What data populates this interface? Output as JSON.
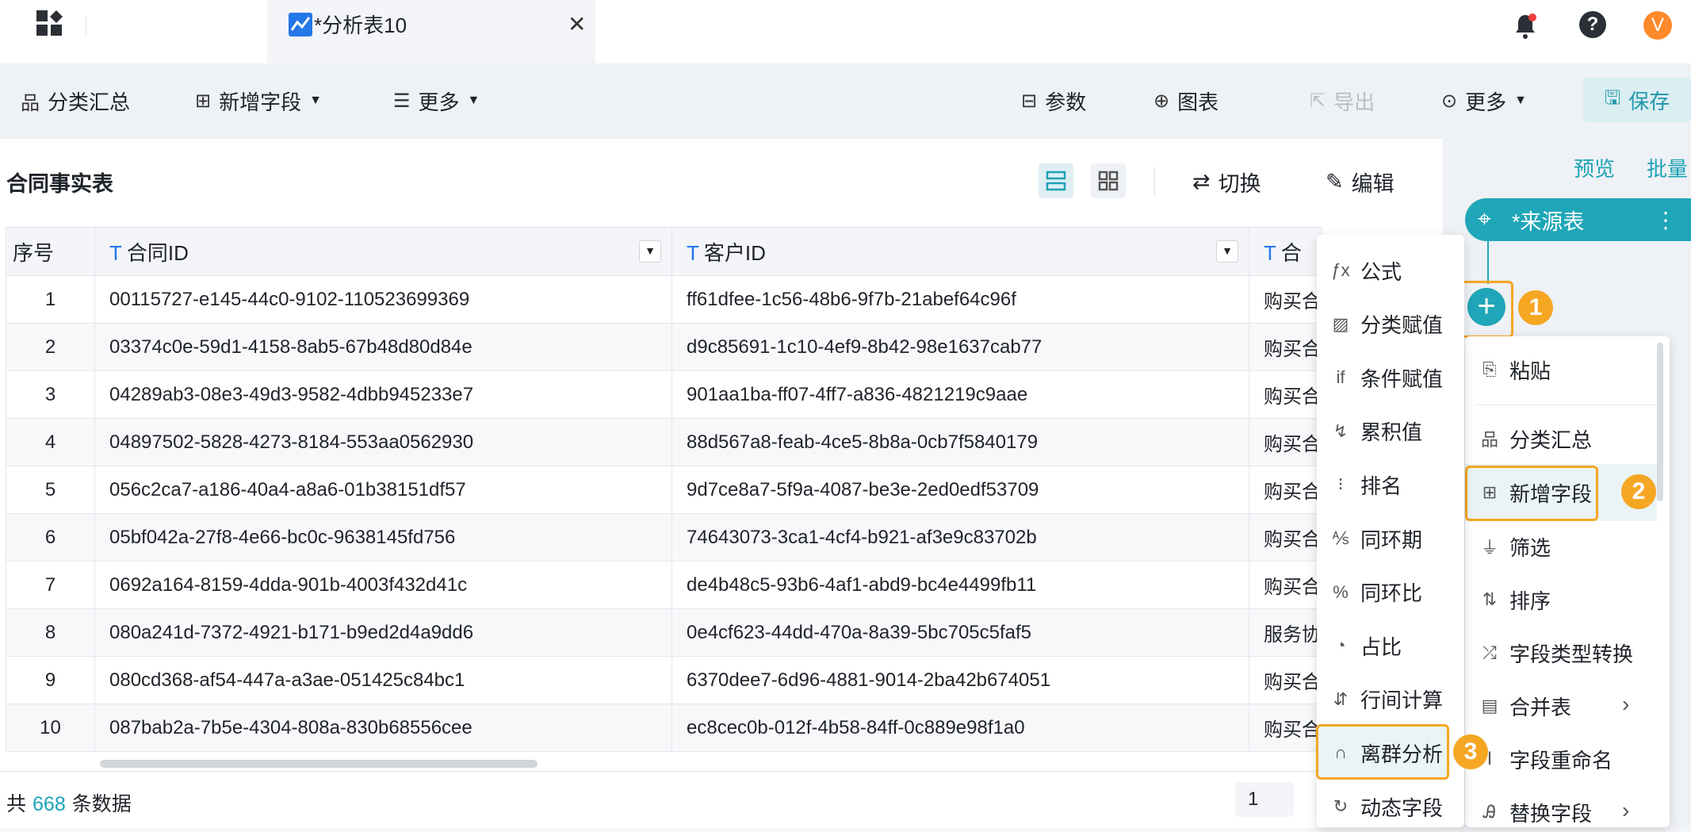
{
  "tab": {
    "title": "*分析表10",
    "close": "✕"
  },
  "header": {
    "avatar_letter": "V",
    "help": "?"
  },
  "toolbar": {
    "group_summary": "分类汇总",
    "add_field": "新增字段",
    "more_left": "更多",
    "params": "参数",
    "chart": "图表",
    "export": "导出",
    "more_right": "更多",
    "save": "保存"
  },
  "table_panel": {
    "title": "合同事实表",
    "switch": "切换",
    "edit": "编辑",
    "columns": [
      "序号",
      "合同ID",
      "客户ID",
      "合"
    ],
    "rows": [
      [
        "1",
        "00115727-e145-44c0-9102-110523699369",
        "ff61dfee-1c56-48b6-9f7b-21abef64c96f",
        "购买合"
      ],
      [
        "2",
        "03374c0e-59d1-4158-8ab5-67b48d80d84e",
        "d9c85691-1c10-4ef9-8b42-98e1637cab77",
        "购买合"
      ],
      [
        "3",
        "04289ab3-08e3-49d3-9582-4dbb945233e7",
        "901aa1ba-ff07-4ff7-a836-4821219c9aae",
        "购买合"
      ],
      [
        "4",
        "04897502-5828-4273-8184-553aa0562930",
        "88d567a8-feab-4ce5-8b8a-0cb7f5840179",
        "购买合"
      ],
      [
        "5",
        "056c2ca7-a186-40a4-a8a6-01b38151df57",
        "9d7ce8a7-5f9a-4087-be3e-2ed0edf53709",
        "购买合"
      ],
      [
        "6",
        "05bf042a-27f8-4e66-bc0c-9638145fd756",
        "74643073-3ca1-4cf4-b921-af3e9c83702b",
        "购买合"
      ],
      [
        "7",
        "0692a164-8159-4dda-901b-4003f432d41c",
        "de4b48c5-93b6-4af1-abd9-bc4e4499fb11",
        "购买合"
      ],
      [
        "8",
        "080a241d-7372-4921-b171-b9ed2d4a9dd6",
        "0e4cf623-44dd-470a-8a39-5bc705c5faf5",
        "服务协"
      ],
      [
        "9",
        "080cd368-af54-447a-a3ae-051425c84bc1",
        "6370dee7-6d96-4881-9014-2ba42b674051",
        "购买合"
      ],
      [
        "10",
        "087bab2a-7b5e-4304-808a-830b68556cee",
        "ec8cec0b-012f-4b58-84ff-0c889e98f1a0",
        "购买合"
      ]
    ],
    "footer": {
      "prefix": "共",
      "count": "668",
      "suffix": "条数据",
      "page": "1"
    }
  },
  "right_panel": {
    "preview": "预览",
    "batch": "批量",
    "source_node": "*来源表",
    "node_menu": "⋮",
    "plus": "+",
    "badges": [
      "1",
      "2",
      "3"
    ]
  },
  "menu_left": {
    "items": [
      "公式",
      "分类赋值",
      "条件赋值",
      "累积值",
      "排名",
      "同环期",
      "同环比",
      "占比",
      "行间计算",
      "离群分析",
      "动态字段"
    ],
    "icons": [
      "fx-icon",
      "category-assign-icon",
      "condition-assign-icon",
      "cumulative-icon",
      "rank-icon",
      "period-icon",
      "ratio-icon",
      "pie-share-icon",
      "row-calc-icon",
      "outlier-icon",
      "dynamic-field-icon"
    ]
  },
  "menu_right": {
    "items": [
      "粘贴",
      "分类汇总",
      "新增字段",
      "筛选",
      "排序",
      "字段类型转换",
      "合并表",
      "字段重命名",
      "替换字段"
    ]
  },
  "colors": {
    "accent": "#1fa6b8",
    "highlight": "#f5a623",
    "blue": "#2477e8"
  }
}
